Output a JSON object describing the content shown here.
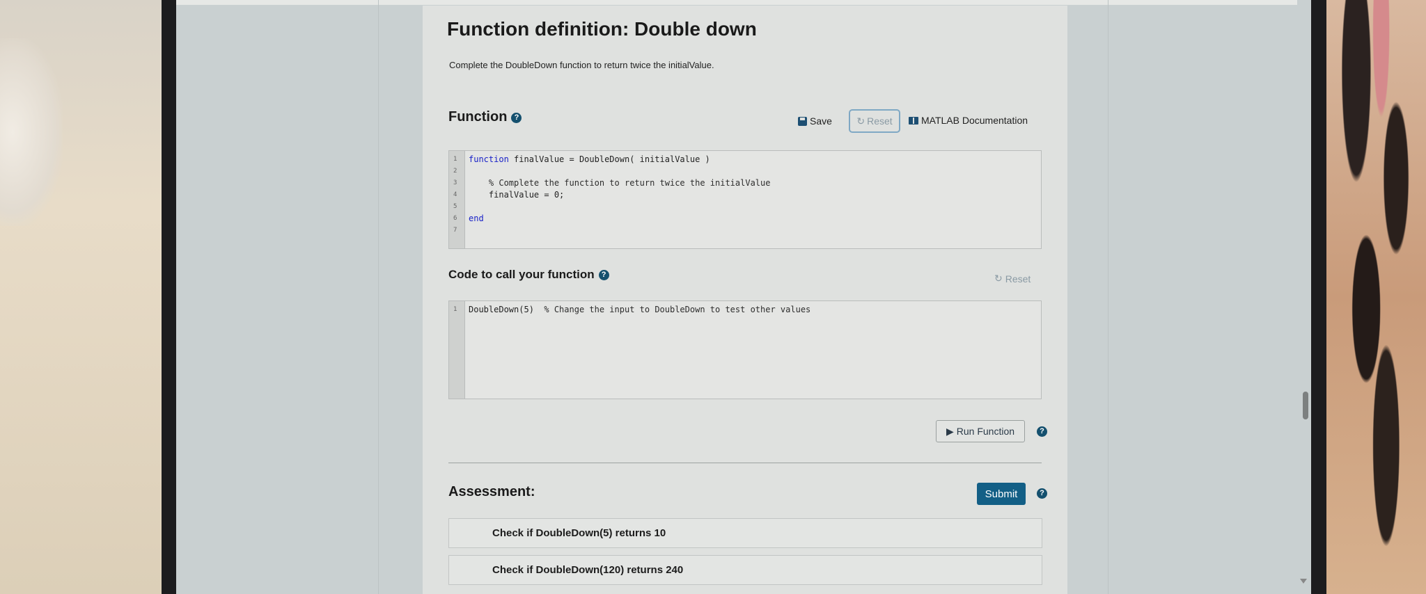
{
  "exercise": {
    "title": "Function definition: Double down",
    "description": "Complete the DoubleDown function to return twice the initialValue."
  },
  "function_section": {
    "heading": "Function",
    "help_icon": "question-circle-icon",
    "save_label": "Save",
    "reset_label": "Reset",
    "docs_label": "MATLAB Documentation",
    "line_numbers": [
      "1",
      "2",
      "3",
      "4",
      "5",
      "6",
      "7"
    ],
    "code": {
      "line1_kw": "function",
      "line1_rest": " finalValue = DoubleDown( initialValue )",
      "line3": "    % Complete the function to return twice the initialValue",
      "line4": "    finalValue = 0;",
      "line6_kw": "end"
    }
  },
  "call_section": {
    "heading": "Code to call your function",
    "reset_label": "Reset",
    "line_numbers": [
      "1"
    ],
    "code_line1_call": "DoubleDown(5)",
    "code_line1_comment": "  % Change the input to DoubleDown to test other values",
    "run_label": "Run Function"
  },
  "assessment": {
    "heading": "Assessment:",
    "submit_label": "Submit",
    "checks": [
      "Check if DoubleDown(5) returns 10",
      "Check if DoubleDown(120) returns 240"
    ]
  },
  "colors": {
    "accent": "#135f86",
    "keyword": "#1a22c8"
  }
}
